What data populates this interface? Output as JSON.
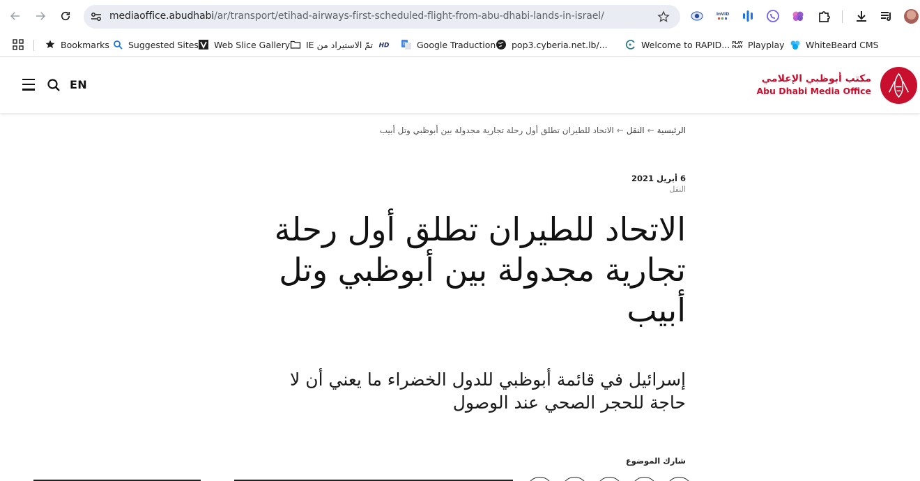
{
  "browser": {
    "url_host": "mediaoffice.abudhabi",
    "url_path": "/ar/transport/etihad-airways-first-scheduled-flight-from-abu-dhabi-lands-in-israel/",
    "extensions": [
      "eye-extension-icon",
      "invid-extension-icon",
      "audio-bars-extension-icon",
      "viber-extension-icon",
      "brain-extension-icon",
      "puzzle-extensions-icon",
      "download-icon",
      "media-queue-icon"
    ]
  },
  "bookmarks": [
    {
      "label": "Bookmarks",
      "icon": "star-icon"
    },
    {
      "label": "Suggested Sites",
      "icon": "search-icon"
    },
    {
      "label": "Web Slice Gallery",
      "icon": "web-slice-icon"
    },
    {
      "label": "تمّ الاستيراد من IE",
      "icon": "folder-icon"
    },
    {
      "label": "",
      "icon": "hd-icon"
    },
    {
      "label": "Google Traduction",
      "icon": "google-translate-icon"
    },
    {
      "label": "pop3.cyberia.net.lb/...",
      "icon": "globe-icon"
    },
    {
      "label": "Welcome to RAPID...",
      "icon": "rapid-icon"
    },
    {
      "label": "Playplay",
      "icon": "playplay-icon"
    },
    {
      "label": "WhiteBeard CMS",
      "icon": "whitebeard-icon"
    }
  ],
  "header": {
    "lang_switch": "EN",
    "logo_ar": "مكتب أبوظبي الإعلامي",
    "logo_en": "Abu Dhabi Media Office"
  },
  "breadcrumb": {
    "home": "الرئيسية",
    "section": "النقل",
    "current": "الاتحاد للطيران تطلق أول رحلة تجارية مجدولة بين أبوظبي وتل أبيب",
    "separator": "←"
  },
  "article": {
    "date": "6 أبريل 2021",
    "category": "النقل",
    "headline": "الاتحاد للطيران تطلق أول رحلة تجارية مجدولة بين أبوظبي وتل أبيب",
    "subheadline": "إسرائيل في قائمة أبوظبي للدول الخضراء ما يعني أن لا حاجة للحجر الصحي عند الوصول",
    "share_label": "شارك الموضوع"
  },
  "colors": {
    "brand_red": "#c8102e",
    "omnibox_bg": "#e9edf3"
  }
}
